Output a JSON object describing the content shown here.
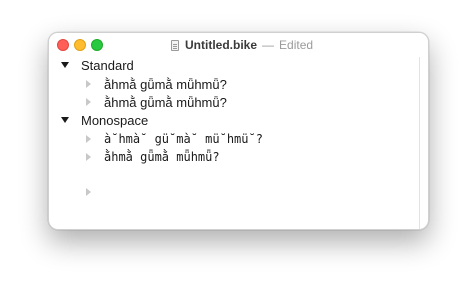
{
  "window": {
    "file_name": "Untitled.bike",
    "separator": "—",
    "status": "Edited"
  },
  "outline": {
    "groups": [
      {
        "label": "Standard",
        "expanded": true,
        "children": [
          "ằhmằ gǖmằ mǖhmǖ?",
          "ằhmằ gǖmằ mǖhmǖ?"
        ]
      },
      {
        "label": "Monospace",
        "expanded": true,
        "children": [
          "à˘hmà˘ gü˘mà˘ mü˘hmü˘?",
          "ằhmằ gǖmằ mǖhmǖ?"
        ]
      }
    ]
  },
  "icons": {
    "file": "document-icon",
    "expanded": "disclosure-down-icon",
    "child": "bullet-right-icon"
  },
  "colors": {
    "close": "#ff5f57",
    "minimize": "#febc2e",
    "zoom": "#28c840",
    "disclosure": "#1a1a1a",
    "bullet": "#c8c8c8",
    "title_status": "#9b9b9b"
  }
}
